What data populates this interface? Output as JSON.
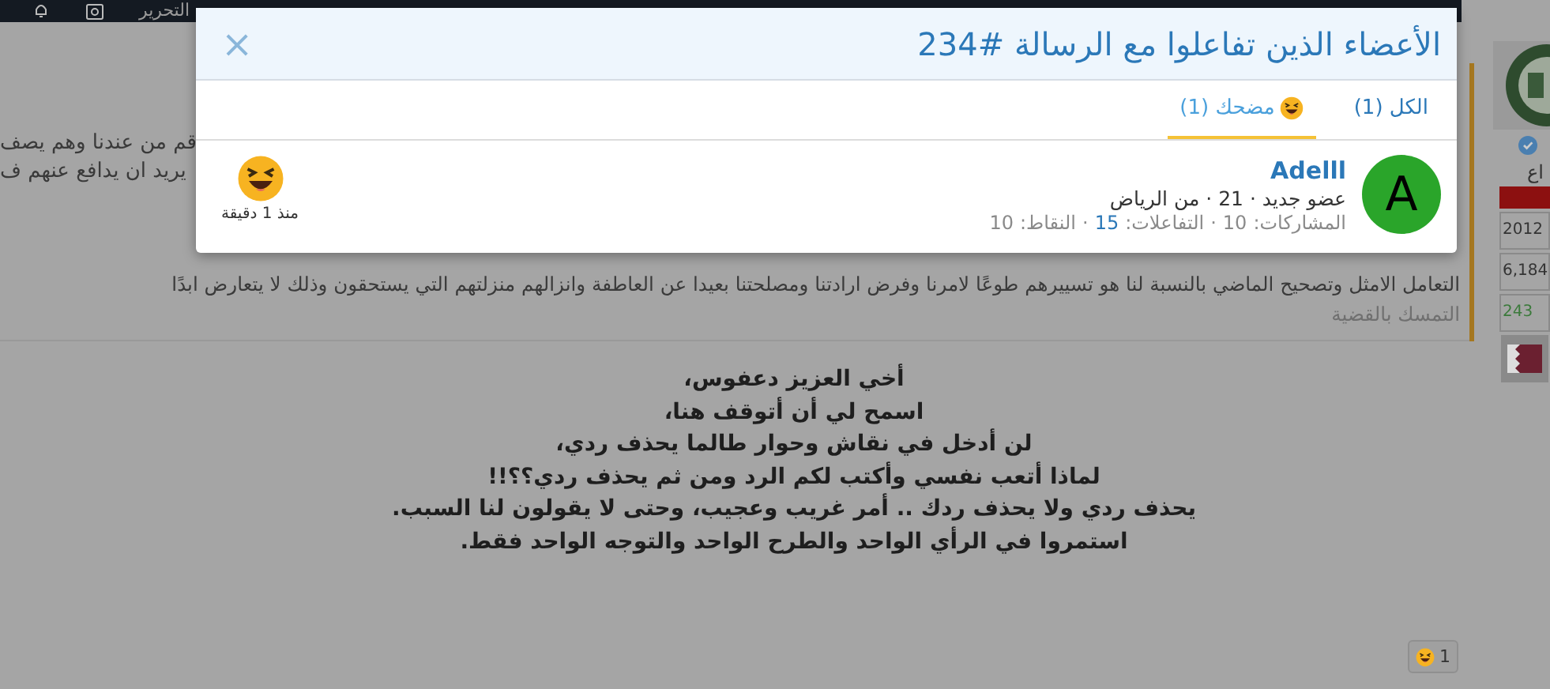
{
  "nav": {
    "items": [
      "التحرير"
    ]
  },
  "background": {
    "fragments": [
      "قم من عندنا وهم يصف",
      "يريد ان يدافع عنهم ف"
    ],
    "paragraph": [
      "التعامل الامثل وتصحيح الماضي بالنسبة لنا هو تسييرهم طوعًا لامرنا وفرض ارادتنا ومصلحتنا بعيدا عن العاطفة وانزالهم منزلتهم التي يستحقون وذلك لا يتعارض ابدًا",
      "التمسك بالقضية"
    ]
  },
  "post": {
    "lines": [
      "أخي العزيز دعفوس،",
      "اسمح لي أن أتوقف هنا،",
      "لن أدخل في نقاش وحوار طالما يحذف ردي،",
      "لماذا أتعب نفسي وأكتب لكم الرد ومن ثم يحذف ردي؟؟!!",
      "يحذف ردي ولا يحذف ردك .. أمر غريب وعجيب، وحتى لا يقولون لنا السبب.",
      "استمروا في الرأي الواحد والطرح الواحد والتوجه الواحد فقط."
    ],
    "reaction_count": "1"
  },
  "sidebar": {
    "role": "اع",
    "stats": [
      "2012",
      "6,184",
      "243"
    ]
  },
  "dialog": {
    "title": "الأعضاء الذين تفاعلوا مع الرسالة #234",
    "close": "×",
    "tabs": [
      {
        "label": "الكل (1)",
        "kind": "all",
        "selected": false
      },
      {
        "label": "مضحك (1)",
        "kind": "laugh",
        "selected": true
      }
    ],
    "members": [
      {
        "avatar_letter": "A",
        "name": "Adelll",
        "info": "عضو جديد · 21 · من الرياض",
        "stats": [
          {
            "label": "المشاركات:",
            "value": "10",
            "kind": "plain"
          },
          {
            "label": "التفاعلات:",
            "value": "15",
            "kind": "link"
          },
          {
            "label": "النقاط:",
            "value": "10",
            "kind": "plain"
          }
        ],
        "stats_separator": "·",
        "time": "منذ 1 دقيقة"
      }
    ]
  }
}
